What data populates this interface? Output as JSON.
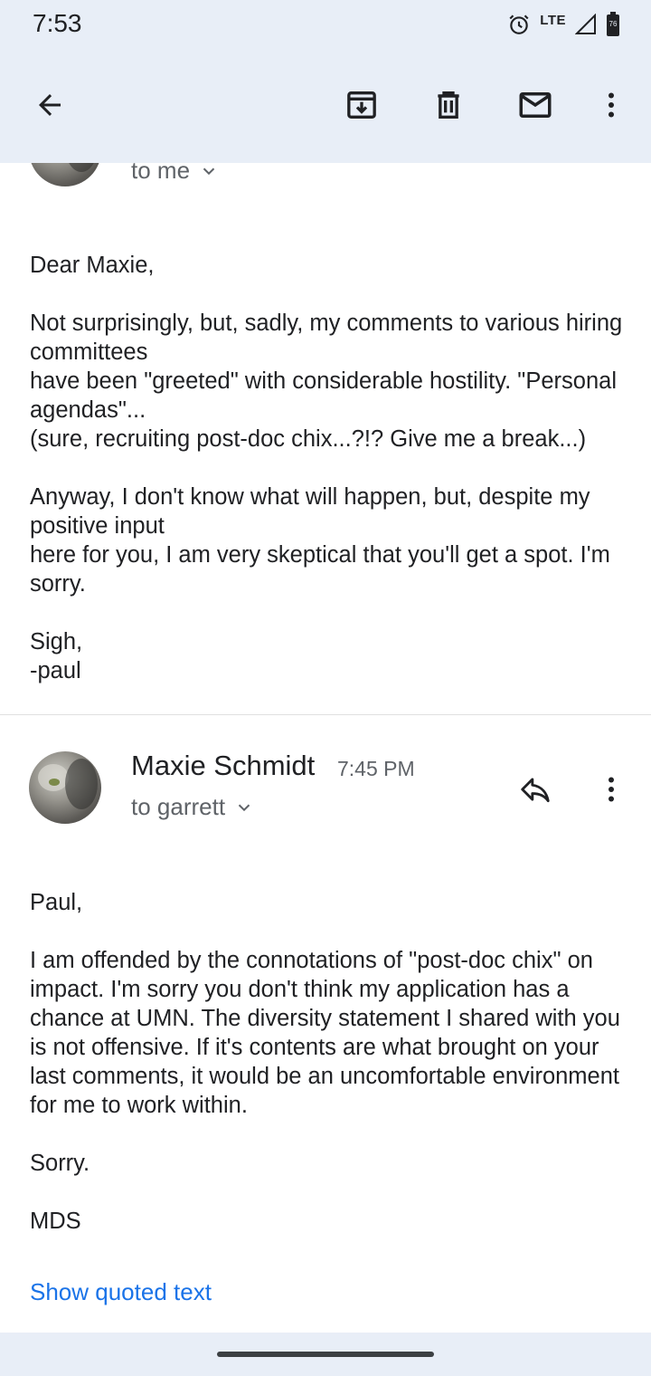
{
  "status_bar": {
    "time": "7:53",
    "network": "LTE",
    "battery": "76"
  },
  "toolbar": {
    "back_icon": "arrow-back-icon",
    "archive_icon": "archive-icon",
    "delete_icon": "trash-icon",
    "mark_unread_icon": "mail-icon",
    "more_icon": "more-vert-icon"
  },
  "message1": {
    "recipient": "to me",
    "body": "Dear Maxie,\n\nNot surprisingly, but, sadly, my comments to various hiring committees\nhave been \"greeted\" with considerable hostility. \"Personal agendas\"...\n(sure, recruiting post-doc chix...?!? Give me a break...)\n\nAnyway, I don't know what will happen, but, despite my positive input\nhere for you, I am very skeptical that you'll get a spot. I'm sorry.\n\nSigh,\n-paul"
  },
  "message2": {
    "sender": "Maxie Schmidt",
    "time": "7:45 PM",
    "recipient": "to garrett",
    "body": "Paul,\n\nI am offended by the connotations of \"post-doc chix\" on impact. I'm sorry you don't think my application has a chance at UMN. The diversity statement I shared with you is not offensive. If it's contents are what brought on your last comments, it would be an uncomfortable environment for me to work within.\n\nSorry.\n\nMDS",
    "show_quoted": "Show quoted text"
  },
  "colors": {
    "appbar_bg": "#e8eef7",
    "link": "#1a73e8",
    "secondary_text": "#5f6368"
  }
}
